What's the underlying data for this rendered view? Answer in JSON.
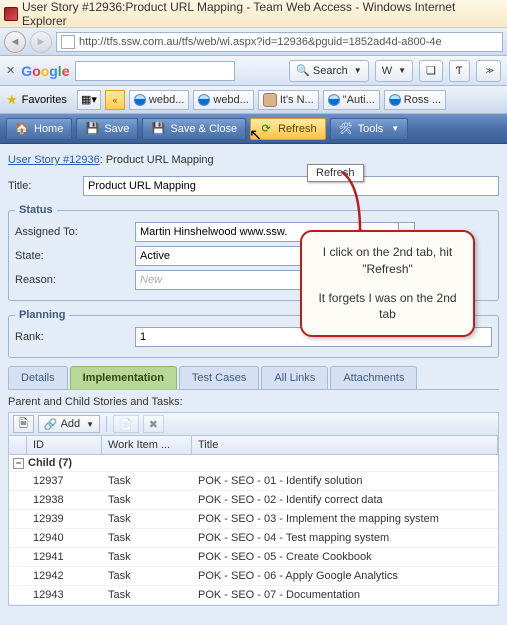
{
  "window": {
    "title": "User Story #12936:Product URL Mapping - Team Web Access - Windows Internet Explorer"
  },
  "address": {
    "url": "http://tfs.ssw.com.au/tfs/web/wi.aspx?id=12936&pguid=1852ad4d-a800-4e"
  },
  "google_toolbar": {
    "search_label": "Search",
    "search_value": ""
  },
  "favorites": {
    "label": "Favorites",
    "items": [
      "webd...",
      "webd...",
      "It's N...",
      "\"Auti...",
      "Ross ..."
    ]
  },
  "tfs_toolbar": {
    "home": "Home",
    "save": "Save",
    "save_close": "Save & Close",
    "refresh": "Refresh",
    "tools": "Tools",
    "refresh_tooltip": "Refresh"
  },
  "breadcrumb": {
    "link": "User Story #12936",
    "tail": ": Product URL Mapping"
  },
  "form": {
    "title_label": "Title:",
    "title_value": "Product URL Mapping",
    "status_legend": "Status",
    "assigned_label": "Assigned To:",
    "assigned_value": "Martin Hinshelwood www.ssw.",
    "state_label": "State:",
    "state_value": "Active",
    "reason_label": "Reason:",
    "reason_value": "New",
    "planning_legend": "Planning",
    "rank_label": "Rank:",
    "rank_value": "1"
  },
  "tabs": {
    "t1": "Details",
    "t2": "Implementation",
    "t3": "Test Cases",
    "t4": "All Links",
    "t5": "Attachments",
    "active": "t2"
  },
  "grid": {
    "heading": "Parent and Child Stories and Tasks:",
    "add_label": "Add",
    "cols": {
      "id": "ID",
      "wit": "Work Item ...",
      "title": "Title"
    },
    "group_label": "Child (7)",
    "rows": [
      {
        "id": "12937",
        "wit": "Task",
        "title": "POK - SEO - 01 - Identify solution"
      },
      {
        "id": "12938",
        "wit": "Task",
        "title": "POK - SEO - 02 - Identify correct data"
      },
      {
        "id": "12939",
        "wit": "Task",
        "title": "POK - SEO - 03 - Implement the mapping system"
      },
      {
        "id": "12940",
        "wit": "Task",
        "title": "POK - SEO - 04 - Test mapping system"
      },
      {
        "id": "12941",
        "wit": "Task",
        "title": "POK - SEO - 05 - Create Cookbook"
      },
      {
        "id": "12942",
        "wit": "Task",
        "title": "POK - SEO - 06 - Apply Google Analytics"
      },
      {
        "id": "12943",
        "wit": "Task",
        "title": "POK - SEO - 07 - Documentation"
      }
    ]
  },
  "callout": {
    "line1": "I click on the 2nd tab, hit \"Refresh\"",
    "line2": "It forgets I was on the 2nd tab"
  }
}
